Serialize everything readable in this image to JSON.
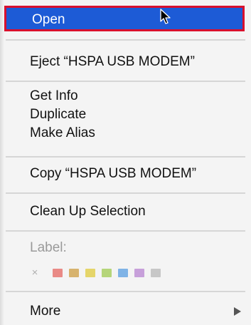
{
  "menu": {
    "open_label": "Open",
    "eject_label": "Eject “HSPA USB MODEM”",
    "get_info_label": "Get Info",
    "duplicate_label": "Duplicate",
    "make_alias_label": "Make Alias",
    "copy_label": "Copy “HSPA USB MODEM”",
    "clean_up_label": "Clean Up Selection",
    "label_title": "Label:",
    "more_label": "More"
  },
  "label_colors": [
    {
      "name": "none",
      "glyph": "×"
    },
    {
      "name": "red",
      "color": "#e98a86"
    },
    {
      "name": "orange",
      "color": "#d7b36e"
    },
    {
      "name": "yellow",
      "color": "#e5d56a"
    },
    {
      "name": "green",
      "color": "#b5d57a"
    },
    {
      "name": "blue",
      "color": "#7fb3e6"
    },
    {
      "name": "purple",
      "color": "#c7a0da"
    },
    {
      "name": "gray",
      "color": "#c7c7c7"
    }
  ],
  "colors": {
    "highlight": "#1d5bd6",
    "highlight_outline": "#d8102e"
  },
  "icons": {
    "cursor": "arrow-cursor-icon",
    "submenu": "chevron-right-icon"
  }
}
